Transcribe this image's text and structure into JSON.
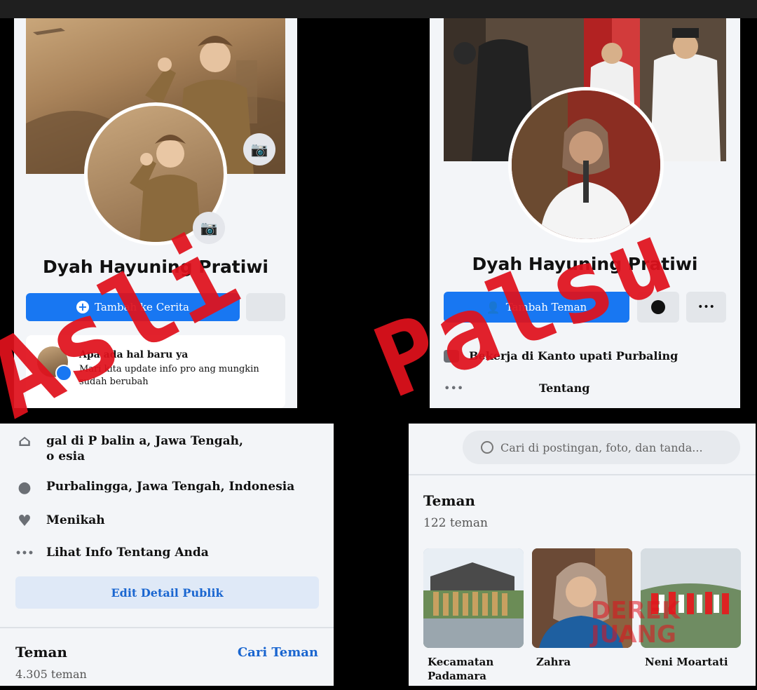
{
  "left_top": {
    "profile_name": "Dyah Hayuning Pratiwi",
    "add_story_label": "Tambah ke Cerita",
    "composer_title": "Apa ada hal baru ya",
    "composer_subtitle": "Mari kita update info pro  ang mungkin sudah berubah"
  },
  "right_top": {
    "profile_name": "Dyah Hayuning Pratiwi",
    "add_friend_label": "Tambah Teman",
    "more_label": "•••",
    "work_text": "Bekerja di Kanto  upati Purbaling",
    "about_text": "Tentang"
  },
  "left_bottom": {
    "details": [
      {
        "icon": "home-icon",
        "text": "  gal di P  balin  a, Jawa Tengah,\n  o  esia"
      },
      {
        "icon": "location-icon",
        "text": "  Purbalingga, Jawa Tengah, Indonesia"
      },
      {
        "icon": "heart-icon",
        "text": "Menikah"
      },
      {
        "icon": "more-icon",
        "text": "Lihat Info Tentang Anda"
      }
    ],
    "edit_button": "Edit Detail Publik",
    "friends_title": "Teman",
    "friends_link": "Cari Teman",
    "friends_count": "4.305 teman"
  },
  "right_bottom": {
    "search_placeholder": "Cari di postingan, foto, dan tanda...",
    "friends_title": "Teman",
    "friends_count": "122 teman",
    "friends": [
      {
        "name": "Kecamatan\nPadamara"
      },
      {
        "name": "Zahra"
      },
      {
        "name": "Neni Moartati"
      }
    ]
  },
  "stamps": {
    "left": "Asli",
    "right": "Palsu"
  },
  "watermark": "DEREK JUANG",
  "colors": {
    "facebook_blue": "#1877f2",
    "stamp_red": "#e0121d"
  }
}
